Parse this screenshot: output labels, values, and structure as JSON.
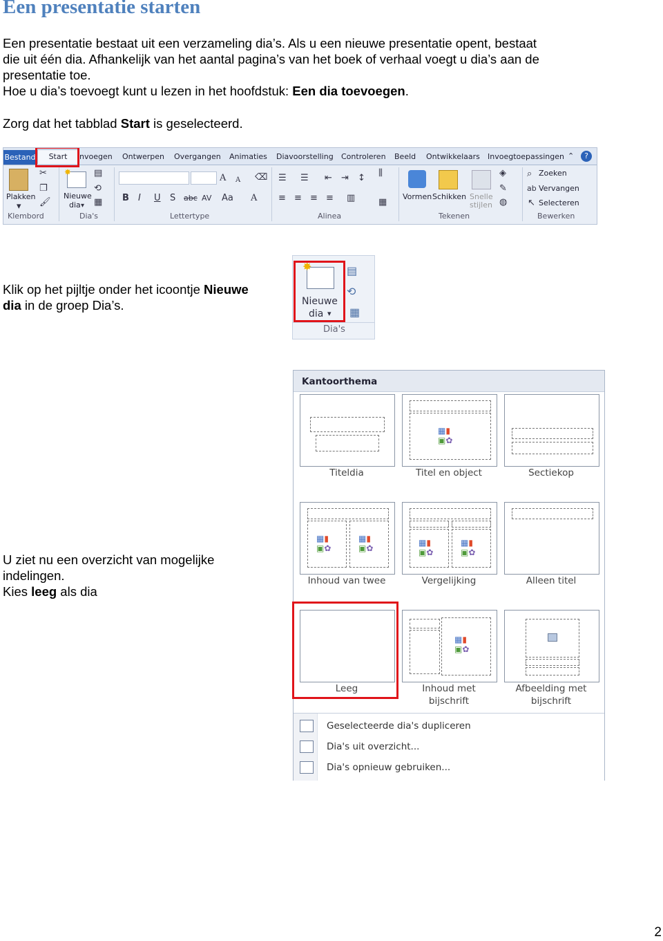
{
  "heading": "Een presentatie starten",
  "para1": {
    "line1": "Een presentatie bestaat uit een verzameling dia’s. Als u een nieuwe presentatie opent, bestaat",
    "line2": "die uit één dia. Afhankelijk van het aantal pagina’s van het boek of verhaal voegt u dia’s aan de",
    "line3": "presentatie toe.",
    "line4_pre": "Hoe u dia’s toevoegt kunt u lezen in het hoofdstuk: ",
    "line4_bold": "Een dia toevoegen",
    "line4_post": "."
  },
  "para2": {
    "pre": "Zorg dat het tabblad ",
    "bold": "Start",
    "post": " is geselecteerd."
  },
  "ribbon": {
    "tabs": [
      "Bestand",
      "Start",
      "nvoegen",
      "Ontwerpen",
      "Overgangen",
      "Animaties",
      "Diavoorstelling",
      "Controleren",
      "Beeld",
      "Ontwikkelaars",
      "Invoegtoepassingen"
    ],
    "groups": [
      "Klembord",
      "Dia's",
      "Lettertype",
      "Alinea",
      "Tekenen",
      "Bewerken"
    ],
    "buttons": {
      "plakken": "Plakken",
      "nieuwe": "Nieuwe",
      "dia": "dia",
      "vormen": "Vormen",
      "schikken": "Schikken",
      "snelle": "Snelle",
      "stijlen": "stijlen",
      "zoeken": "Zoeken",
      "vervangen": "Vervangen",
      "selecteren": "Selecteren"
    }
  },
  "para3": {
    "line1_pre": "Klik op het pijltje onder het icoontje ",
    "line1_bold": "Nieuwe",
    "line2_bold": "dia",
    "line2_post": " in de groep Dia’s."
  },
  "zoom": {
    "nieuwe": "Nieuwe",
    "dia": "dia",
    "group": "Dia's"
  },
  "gallery": {
    "title": "Kantoorthema",
    "layouts": [
      "Titeldia",
      "Titel en object",
      "Sectiekop",
      "Inhoud van twee",
      "Vergelijking",
      "Alleen titel",
      "Leeg",
      "Inhoud met bijschrift",
      "Afbeelding met bijschrift"
    ],
    "menu": [
      "Geselecteerde dia's dupliceren",
      "Dia's uit overzicht...",
      "Dia's opnieuw gebruiken..."
    ]
  },
  "para4": {
    "line1": "U ziet nu een overzicht van mogelijke",
    "line2": "indelingen.",
    "line3_pre": "Kies ",
    "line3_bold": "leeg",
    "line3_post": " als dia"
  },
  "page_number": "2"
}
